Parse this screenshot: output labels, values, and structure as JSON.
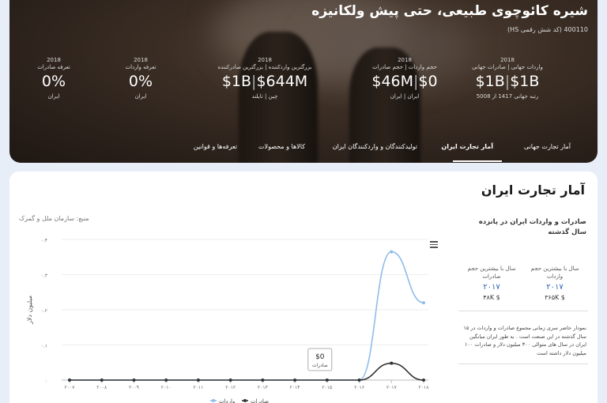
{
  "hero": {
    "title": "شیره کائوچوی طبیعی، حتی پیش ولکانیزه",
    "subtitle": "400110 (کد شش رقمی HS)",
    "stats": [
      {
        "year": "2018",
        "label": "واردات جهانی | صادرات جهانی",
        "value_a": "$1B",
        "value_b": "$1B",
        "footer": "رتبه جهانی 1417 از 5008"
      },
      {
        "year": "2018",
        "label": "حجم واردات | حجم صادرات",
        "value_a": "$0",
        "value_b": "$46M",
        "footer": "ایران | ایران"
      },
      {
        "year": "2018",
        "label": "بزرگترین واردکننده | بزرگترین صادرکننده",
        "value_a": "$1B",
        "value_b": "$644M",
        "footer": "چین | تایلند"
      },
      {
        "year": "2018",
        "label": "تعرفه واردات",
        "value_a": "0%",
        "value_b": "0",
        "footer": "ایران"
      },
      {
        "year": "2018",
        "label": "تعرفه صادرات",
        "value_a": "0%",
        "value_b": "0",
        "footer": "ایران"
      }
    ],
    "tabs": [
      "آمار تجارت جهانی",
      "آمار تجارت ایران",
      "تولیدکنندگان و واردکنندگان ایران",
      "کالاها و محصولات",
      "تعرفه‌ها و قوانین"
    ]
  },
  "main": {
    "section_title": "آمار تجارت ایران",
    "source": "منبع: سازمان ملل و گمرک",
    "side_heading": "صادرات و واردات ایران در پانزده سال گذشته",
    "kpis": [
      {
        "label": "سال با بیشترین حجم واردات",
        "year": "۲۰۱۷",
        "value": "$ ۳۶۵K"
      },
      {
        "label": "سال با بیشترین حجم صادرات",
        "year": "۲۰۱۷",
        "value": "$ ۴۸K"
      }
    ],
    "description": "نمودار حاضر سری زمانی مجموع صادرات و واردات در ۱۵ سال گذشته در این صنعت است . به طور ایران میانگین ایران در سال های متوالی ۳۰۰ میلیون دلار و صادرات ۱۰۰ میلیون دلار داشته است"
  },
  "chart_data": {
    "type": "line",
    "x": [
      "۲۰۰۷",
      "۲۰۰۸",
      "۲۰۰۹",
      "۲۰۱۰",
      "۲۰۱۱",
      "۲۰۱۲",
      "۲۰۱۳",
      "۲۰۱۴",
      "۲۰۱۵",
      "۲۰۱۶",
      "۲۰۱۷",
      "۲۰۱۸"
    ],
    "y_ticks": [
      "۰",
      "۰.۱",
      "۰.۲",
      "۰.۳",
      "۰.۴"
    ],
    "ylim": [
      0,
      0.4
    ],
    "ylabel": "میلیون دلار",
    "series": [
      {
        "name": "واردات",
        "color": "#8fbcea",
        "values": [
          0,
          0,
          0,
          0,
          0,
          0,
          0,
          0,
          0,
          0,
          0.365,
          0.22
        ]
      },
      {
        "name": "صادرات",
        "color": "#333333",
        "values": [
          0,
          0,
          0,
          0,
          0,
          0,
          0,
          0,
          0,
          0,
          0.048,
          0
        ]
      }
    ],
    "tooltip": {
      "value": "$0",
      "label": "صادرات",
      "index": 8
    }
  }
}
